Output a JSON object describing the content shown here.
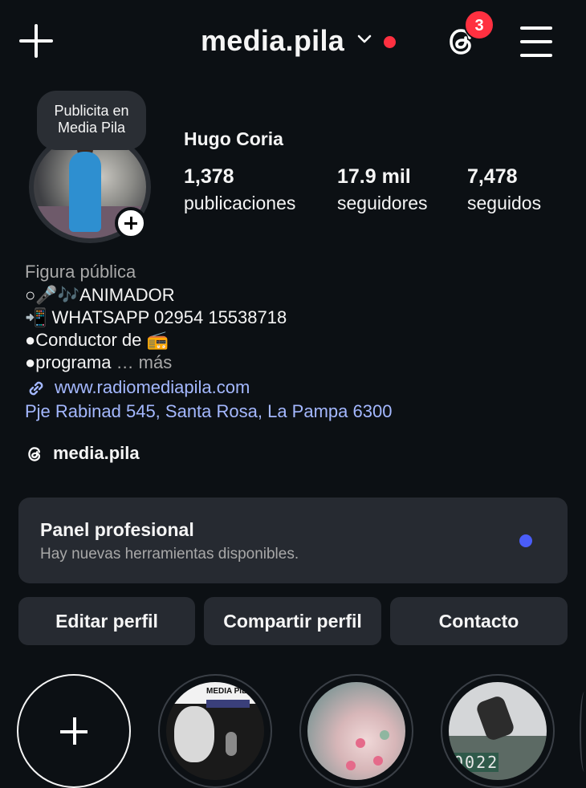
{
  "header": {
    "username": "media.pila",
    "threads_badge": "3",
    "icons": {
      "new": "plus-icon",
      "switch": "chevron-down-icon",
      "threads": "threads-icon",
      "menu": "hamburger-menu-icon"
    }
  },
  "profile": {
    "note": "Publicita en Media Pila",
    "display_name": "Hugo Coria",
    "stats": {
      "posts": {
        "value": "1,378",
        "label": "publicaciones"
      },
      "followers": {
        "value": "17.9 mil",
        "label": "seguidores"
      },
      "following": {
        "value": "7,478",
        "label": "seguidos"
      }
    }
  },
  "bio": {
    "category": "Figura pública",
    "line1": "○🎤🎶ANIMADOR",
    "line2": "📲 WHATSAPP 02954 15538718",
    "line3": "●Conductor de 📻",
    "line4": "●programa",
    "more": " … más",
    "link": "www.radiomediapila.com",
    "address": "Pje Rabinad 545, Santa Rosa, La Pampa 6300",
    "threads_handle": "media.pila"
  },
  "panel": {
    "title": "Panel profesional",
    "subtitle": "Hay nuevas herramientas disponibles."
  },
  "buttons": {
    "edit": "Editar perfil",
    "share": "Compartir perfil",
    "contact": "Contacto"
  },
  "highlights": {
    "first_header": "MEDIA PIL",
    "score": "0022"
  },
  "colors": {
    "background": "#0c1014",
    "surface": "#262a31",
    "link": "#a4b8ff",
    "notification": "#ff3040",
    "accent_dot": "#4a5df9"
  }
}
